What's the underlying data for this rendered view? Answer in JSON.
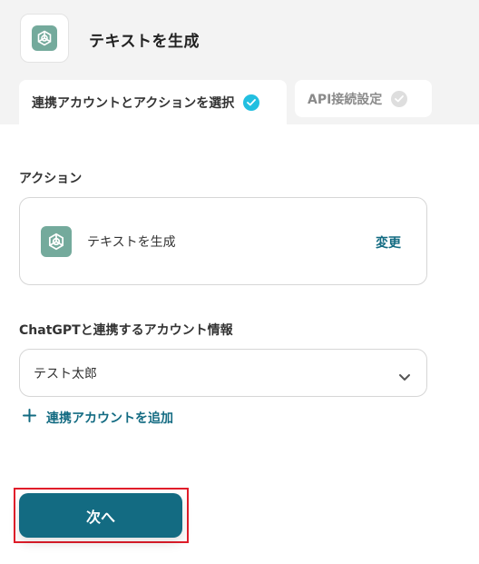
{
  "header": {
    "title": "テキストを生成",
    "app_icon": "openai-icon",
    "tabs": [
      {
        "label": "連携アカウントとアクションを選択",
        "state": "active",
        "check_color": "#22bfe0"
      },
      {
        "label": "API接続設定",
        "state": "inactive",
        "check_color": "#dedede"
      }
    ]
  },
  "action_section": {
    "label": "アクション",
    "action_name": "テキストを生成",
    "change_label": "変更",
    "icon": "openai-icon"
  },
  "account_section": {
    "label": "ChatGPTと連携するアカウント情報",
    "selected_account": "テスト太郎",
    "dropdown_icon": "chevron-down-icon",
    "add_account_label": "連携アカウントを追加",
    "add_icon": "plus-icon"
  },
  "footer": {
    "next_label": "次へ"
  },
  "colors": {
    "accent": "#136b82",
    "openai_brand": "#74aa9c",
    "highlight_outline": "#e11d2a"
  }
}
